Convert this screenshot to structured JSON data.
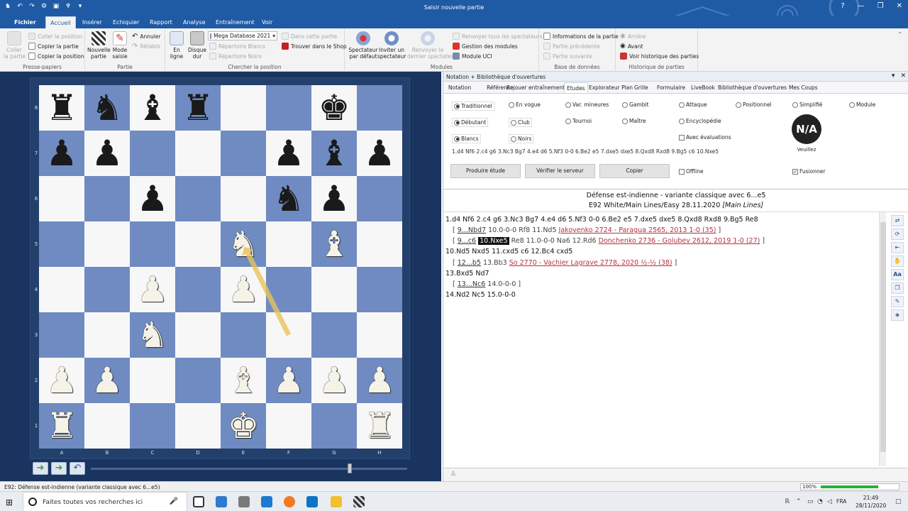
{
  "window": {
    "title": "Saisir nouvelle partie"
  },
  "ribbon": {
    "file_tab": "Fichier",
    "tabs": [
      "Accueil",
      "Insérer",
      "Echiquier",
      "Rapport",
      "Analyse",
      "Entraînement",
      "Voir"
    ],
    "groups": {
      "clipboard": {
        "label": "Presse-papiers",
        "paste": "Coller\nla partie",
        "paste_position": "Coller la position",
        "copy_game": "Copier la partie",
        "copy_position": "Copier la position"
      },
      "game": {
        "label": "Partie",
        "new_game": "Nouvelle\npartie",
        "input_mode": "Mode\nsaisie",
        "undo": "Annuler",
        "redo": "Rétablir"
      },
      "search": {
        "label": "Chercher la position",
        "online": "En\nligne",
        "hard_disk": "Disque\ndur",
        "database": "Mega Database 2021",
        "rep_white": "Répertoire Blancs",
        "rep_black": "Répertoire Noirs",
        "in_game": "Dans cette partie",
        "shop": "Trouver dans le Shop"
      },
      "modules": {
        "label": "Modules",
        "default_spectator": "Spectateur\npar défaut",
        "invite_spectator": "Inviter un\nspectateur",
        "return_last": "Renvoyer le\ndernier spectateur",
        "return_all": "Renvoyer tous les spectateurs",
        "manage": "Gestion des modules",
        "uci": "Module UCI"
      },
      "database": {
        "label": "Base de données",
        "info": "Informations de la partie",
        "prev": "Partie précédente",
        "next": "Partie suivante"
      },
      "history": {
        "label": "Historique de parties",
        "back": "Arrière",
        "forward": "Avant",
        "view": "Voir historique des parties"
      }
    }
  },
  "board": {
    "files": [
      "A",
      "B",
      "C",
      "D",
      "E",
      "F",
      "G",
      "H"
    ],
    "ranks": [
      "8",
      "7",
      "6",
      "5",
      "4",
      "3",
      "2",
      "1"
    ],
    "pieces": [
      {
        "sq": "a8",
        "color": "b",
        "type": "R"
      },
      {
        "sq": "b8",
        "color": "b",
        "type": "N"
      },
      {
        "sq": "c8",
        "color": "b",
        "type": "B"
      },
      {
        "sq": "d8",
        "color": "b",
        "type": "R"
      },
      {
        "sq": "g8",
        "color": "b",
        "type": "K"
      },
      {
        "sq": "a7",
        "color": "b",
        "type": "P"
      },
      {
        "sq": "b7",
        "color": "b",
        "type": "P"
      },
      {
        "sq": "f7",
        "color": "b",
        "type": "P"
      },
      {
        "sq": "g7",
        "color": "b",
        "type": "B"
      },
      {
        "sq": "h7",
        "color": "b",
        "type": "P"
      },
      {
        "sq": "c6",
        "color": "b",
        "type": "P"
      },
      {
        "sq": "f6",
        "color": "b",
        "type": "N"
      },
      {
        "sq": "g6",
        "color": "b",
        "type": "P"
      },
      {
        "sq": "e5",
        "color": "w",
        "type": "N"
      },
      {
        "sq": "g5",
        "color": "w",
        "type": "B"
      },
      {
        "sq": "c4",
        "color": "w",
        "type": "P"
      },
      {
        "sq": "e4",
        "color": "w",
        "type": "P"
      },
      {
        "sq": "c3",
        "color": "w",
        "type": "N"
      },
      {
        "sq": "a2",
        "color": "w",
        "type": "P"
      },
      {
        "sq": "b2",
        "color": "w",
        "type": "P"
      },
      {
        "sq": "e2",
        "color": "w",
        "type": "B"
      },
      {
        "sq": "f2",
        "color": "w",
        "type": "P"
      },
      {
        "sq": "g2",
        "color": "w",
        "type": "P"
      },
      {
        "sq": "h2",
        "color": "w",
        "type": "P"
      },
      {
        "sq": "a1",
        "color": "w",
        "type": "R"
      },
      {
        "sq": "e1",
        "color": "w",
        "type": "K"
      },
      {
        "sq": "h1",
        "color": "w",
        "type": "R"
      }
    ],
    "arrow": {
      "from": "f3",
      "to": "e5",
      "color": "#e8c25a"
    },
    "colors": {
      "light": "#f7f7f7",
      "dark": "#6f8bc2"
    }
  },
  "panel": {
    "title": "Notation + Bibliothèque d'ouvertures",
    "tabs": [
      "Notation",
      "Référence",
      "Rejouer entraînement",
      "Etudes",
      "Explorateur Plan",
      "Grille",
      "Formulaire",
      "LiveBook",
      "Bibliothèque d'ouvertures",
      "Mes Coups"
    ],
    "active_tab": "Etudes",
    "options": {
      "row1": [
        {
          "label": "Traditionnel",
          "on": true
        },
        {
          "label": "En vogue",
          "on": false
        },
        {
          "label": "Var. mineures",
          "on": false
        },
        {
          "label": "Gambit",
          "on": false
        },
        {
          "label": "Attaque",
          "on": false
        },
        {
          "label": "Positionnel",
          "on": false
        },
        {
          "label": "Simplifié",
          "on": false
        },
        {
          "label": "Module",
          "on": false
        }
      ],
      "row2": [
        {
          "label": "Débutant",
          "on": true
        },
        {
          "label": "Club",
          "on": false
        },
        {
          "label": "Tournoi",
          "on": false
        },
        {
          "label": "Maître",
          "on": false
        },
        {
          "label": "Encyclopédie",
          "on": false
        }
      ],
      "row3": [
        {
          "label": "Blancs",
          "on": true
        },
        {
          "label": "Noirs",
          "on": false
        }
      ],
      "avec_evaluations": "Avec évaluations",
      "moveline": "1.d4 Nf6 2.c4 g6 3.Nc3 Bg7 4.e4 d6 5.Nf3 0-0 6.Be2 e5 7.dxe5 dxe5 8.Qxd8 Rxd8 9.Bg5 c6 10.Nxe5",
      "buttons": [
        "Produire étude",
        "Vérifier le serveur",
        "Copier"
      ],
      "offline": "Offline",
      "fusionner": "Fusionner",
      "badge": "N/A",
      "badge_label": "Veuillez"
    },
    "header": {
      "line1": "Défense est-indienne - variante classique avec 6...e5",
      "line2": "E92 White/Main Lines/Easy 28.11.2020",
      "line2_tag": "[Main Lines]"
    },
    "notation": {
      "main1": "1.d4  Nf6  2.c4  g6  3.Nc3  Bg7  4.e4  d6  5.Nf3  0-0  6.Be2  e5  7.dxe5  dxe5  8.Qxd8  Rxd8  9.Bg5  Re8",
      "v1_move": "9...Nbd7",
      "v1_rest": "10.0-0-0  Rf8  11.Nd5",
      "v1_ref": "Jakovenko 2724 - Paragua 2565, 2013 1-0 (35)",
      "v2_move": "9...c6",
      "v2_hl": "10.Nxe5",
      "v2_rest": "Re8  11.0-0-0  Na6  12.Rd6",
      "v2_ref": "Donchenko 2736 - Golubev 2612, 2019 1-0 (27)",
      "main2": "10.Nd5  Nxd5  11.cxd5  c6  12.Bc4  cxd5",
      "v3_move": "12...b5",
      "v3_rest": "13.Bb3",
      "v3_ref": "So 2770 - Vachier Lagrave 2778, 2020 ½-½ (38)",
      "main3": "13.Bxd5  Nd7",
      "v4_move": "13...Nc6",
      "v4_rest": "14.0-0-0",
      "main4": "14.Nd2  Nc5  15.0-0-0"
    }
  },
  "statusbar": {
    "text": "E92: Défense est-indienne (variante classique avec 6...e5)",
    "zoom": "100%",
    "zoom_level": 0.75
  },
  "taskbar": {
    "search_placeholder": "Faites toutes vos recherches ici",
    "lang": "FRA",
    "time": "21:49",
    "date": "28/11/2020"
  }
}
